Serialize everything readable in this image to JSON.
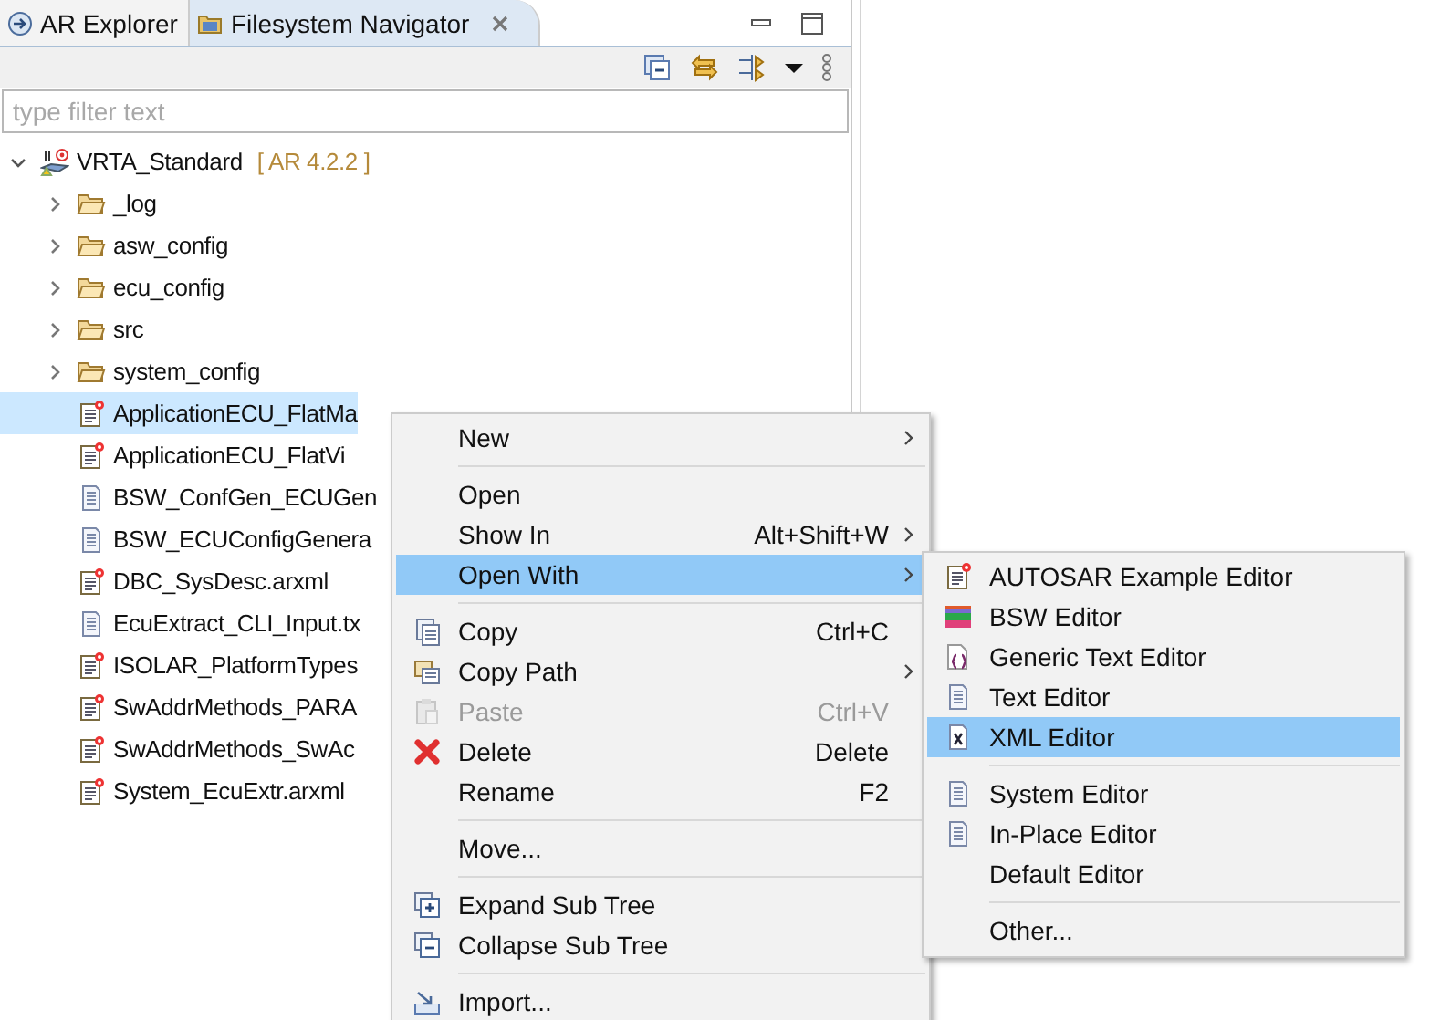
{
  "tabs": [
    {
      "label": "AR Explorer",
      "selected": false,
      "closable": false
    },
    {
      "label": "Filesystem Navigator",
      "selected": true,
      "closable": true
    }
  ],
  "filter": {
    "placeholder": "type filter text"
  },
  "tree": [
    {
      "label": "VRTA_Standard",
      "suffix": "[ AR 4.2.2 ]",
      "kind": "project",
      "expanded": true,
      "selected": false,
      "children": [
        {
          "label": "_log",
          "kind": "folder",
          "expanded": false,
          "selected": false
        },
        {
          "label": "asw_config",
          "kind": "folder",
          "expanded": false,
          "selected": false
        },
        {
          "label": "ecu_config",
          "kind": "folder",
          "expanded": false,
          "selected": false
        },
        {
          "label": "src",
          "kind": "folder",
          "expanded": false,
          "selected": false
        },
        {
          "label": "system_config",
          "kind": "folder",
          "expanded": false,
          "selected": false
        },
        {
          "label": "ApplicationECU_FlatMa",
          "kind": "arxml",
          "selected": true
        },
        {
          "label": "ApplicationECU_FlatVi",
          "kind": "arxml",
          "selected": false
        },
        {
          "label": "BSW_ConfGen_ECUGen",
          "kind": "text",
          "selected": false
        },
        {
          "label": "BSW_ECUConfigGenera",
          "kind": "text",
          "selected": false
        },
        {
          "label": "DBC_SysDesc.arxml",
          "kind": "arxml",
          "selected": false
        },
        {
          "label": "EcuExtract_CLI_Input.tx",
          "kind": "text",
          "selected": false
        },
        {
          "label": "ISOLAR_PlatformTypes",
          "kind": "arxml",
          "selected": false
        },
        {
          "label": "SwAddrMethods_PARA",
          "kind": "arxml",
          "selected": false
        },
        {
          "label": "SwAddrMethods_SwAc",
          "kind": "arxml",
          "selected": false
        },
        {
          "label": "System_EcuExtr.arxml",
          "kind": "arxml",
          "selected": false
        }
      ]
    }
  ],
  "context_menu": [
    {
      "kind": "item",
      "label": "New",
      "has_submenu": true,
      "selected": false,
      "disabled": false
    },
    {
      "kind": "separator"
    },
    {
      "kind": "item",
      "label": "Open",
      "has_submenu": false,
      "selected": false,
      "disabled": false
    },
    {
      "kind": "item",
      "label": "Show In",
      "shortcut": "Alt+Shift+W",
      "has_submenu": true,
      "selected": false,
      "disabled": false
    },
    {
      "kind": "item",
      "label": "Open With",
      "has_submenu": true,
      "selected": true,
      "disabled": false
    },
    {
      "kind": "separator"
    },
    {
      "kind": "item",
      "label": "Copy",
      "shortcut": "Ctrl+C",
      "has_submenu": false,
      "selected": false,
      "disabled": false
    },
    {
      "kind": "item",
      "label": "Copy Path",
      "has_submenu": true,
      "selected": false,
      "disabled": false
    },
    {
      "kind": "item",
      "label": "Paste",
      "shortcut": "Ctrl+V",
      "has_submenu": false,
      "selected": false,
      "disabled": true
    },
    {
      "kind": "item",
      "label": "Delete",
      "shortcut": "Delete",
      "has_submenu": false,
      "selected": false,
      "disabled": false
    },
    {
      "kind": "item",
      "label": "Rename",
      "shortcut": "F2",
      "has_submenu": false,
      "selected": false,
      "disabled": false
    },
    {
      "kind": "separator"
    },
    {
      "kind": "item",
      "label": "Move...",
      "has_submenu": false,
      "selected": false,
      "disabled": false
    },
    {
      "kind": "separator"
    },
    {
      "kind": "item",
      "label": "Expand Sub Tree",
      "has_submenu": false,
      "selected": false,
      "disabled": false
    },
    {
      "kind": "item",
      "label": "Collapse Sub Tree",
      "has_submenu": false,
      "selected": false,
      "disabled": false
    },
    {
      "kind": "separator"
    },
    {
      "kind": "item",
      "label": "Import...",
      "has_submenu": false,
      "selected": false,
      "disabled": false
    }
  ],
  "submenu": [
    {
      "kind": "item",
      "label": "AUTOSAR Example Editor",
      "selected": false
    },
    {
      "kind": "item",
      "label": "BSW Editor",
      "selected": false
    },
    {
      "kind": "item",
      "label": "Generic Text Editor",
      "selected": false
    },
    {
      "kind": "item",
      "label": "Text Editor",
      "selected": false
    },
    {
      "kind": "item",
      "label": "XML Editor",
      "selected": true
    },
    {
      "kind": "separator"
    },
    {
      "kind": "item",
      "label": "System Editor",
      "selected": false
    },
    {
      "kind": "item",
      "label": "In-Place Editor",
      "selected": false
    },
    {
      "kind": "item",
      "label": "Default Editor",
      "selected": false
    },
    {
      "kind": "separator"
    },
    {
      "kind": "item",
      "label": "Other...",
      "selected": false
    }
  ]
}
